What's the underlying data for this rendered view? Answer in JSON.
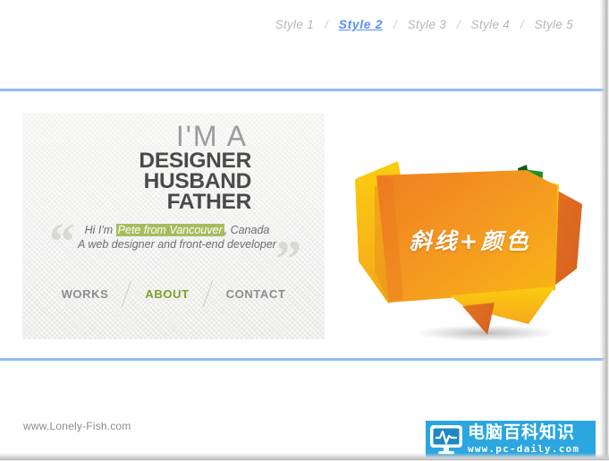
{
  "topnav": {
    "items": [
      {
        "label": "Style 1",
        "active": false
      },
      {
        "label": "Style 2",
        "active": true
      },
      {
        "label": "Style 3",
        "active": false
      },
      {
        "label": "Style 4",
        "active": false
      },
      {
        "label": "Style 5",
        "active": false
      }
    ],
    "separator": "/",
    "active_color": "#5b8ef6",
    "inactive_color": "#b6b6b6"
  },
  "divider_color": "#8fbdf7",
  "card": {
    "intro": "I'M A",
    "roles": [
      "DESIGNER",
      "HUSBAND",
      "FATHER"
    ],
    "quote": {
      "open_mark": "“",
      "close_mark": "”",
      "line1_prefix": "Hi I'm ",
      "line1_highlight": "Pete from Vancouver",
      "line1_suffix": ", Canada",
      "line2": "A web designer and front-end developer",
      "highlight_color": "#a8bc5e"
    },
    "nav": [
      {
        "label": "WORKS",
        "active": false
      },
      {
        "label": "ABOUT",
        "active": true
      },
      {
        "label": "CONTACT",
        "active": false
      }
    ],
    "nav_active_color": "#7ba02b"
  },
  "banner": {
    "text": "斜线+颜色",
    "colors": {
      "main_orange": "#ef8022",
      "light_orange": "#f59b21",
      "yellow": "#f9c012",
      "deep_orange": "#e06a22",
      "green_tab": "#1f9129",
      "green_tab_dark": "#15731f"
    }
  },
  "footer": {
    "url": "www.Lonely-Fish.com"
  },
  "watermark": {
    "cn_title": "电脑百科知识",
    "url": "www.pc-daily.com",
    "background": "#2ba6e0"
  }
}
